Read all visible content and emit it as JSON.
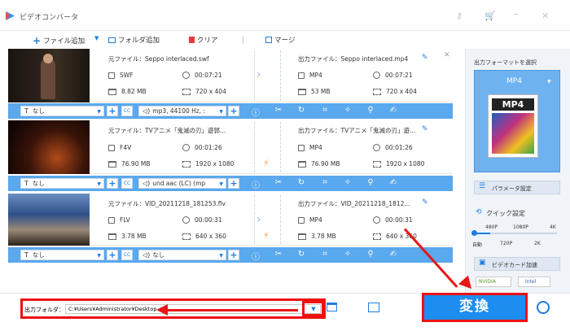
{
  "window": {
    "title": "ビデオコンバータ",
    "icons": [
      "key-icon",
      "cart-icon",
      "minimize-icon",
      "close-icon"
    ]
  },
  "toolbar": {
    "add_file": "ファイル追加",
    "add_folder": "フォルダ追加",
    "clear": "クリア",
    "merge": "マージ"
  },
  "files": [
    {
      "source_label": "元ファイル：",
      "source_name": "Seppo interlaced.swf",
      "src_format": "SWF",
      "src_duration": "00:07:21",
      "src_size": "8.82 MB",
      "src_resolution": "720 x 404",
      "output_label": "出力ファイル：",
      "output_name": "Seppo interlaced.mp4",
      "out_format": "MP4",
      "out_duration": "00:07:21",
      "out_size": "53 MB",
      "out_resolution": "720 x 404",
      "subtitle": "なし",
      "audio": "mp3, 44100 Hz, :"
    },
    {
      "source_label": "元ファイル：",
      "source_name": "TVアニメ「鬼滅の刃」遊郭...",
      "src_format": "F4V",
      "src_duration": "00:01:26",
      "src_size": "76.90 MB",
      "src_resolution": "1920 x 1080",
      "output_label": "出力ファイル：",
      "output_name": "TVアニメ「鬼滅の刃」遊...",
      "out_format": "MP4",
      "out_duration": "00:01:26",
      "out_size": "76.90 MB",
      "out_resolution": "1920 x 1080",
      "subtitle": "なし",
      "audio": "und aac (LC) (mp"
    },
    {
      "source_label": "元ファイル：",
      "source_name": "VID_20211218_181253.flv",
      "src_format": "FLV",
      "src_duration": "00:00:31",
      "src_size": "3.78 MB",
      "src_resolution": "640 x 360",
      "output_label": "出力ファイル：",
      "output_name": "VID_20211218_1812...",
      "out_format": "MP4",
      "out_duration": "00:00:31",
      "out_size": "3.78 MB",
      "out_resolution": "640 x 360",
      "subtitle": "なし",
      "audio": "なし"
    }
  ],
  "right_panel": {
    "output_format_heading": "出力フォーマットを選択",
    "format_selected": "MP4",
    "format_icon_label": "MP4",
    "params_button": "パラメータ設定",
    "quick_settings": "クイック設定",
    "quality_top": [
      "480P",
      "1080P",
      "4K"
    ],
    "quality_bottom": [
      "自動",
      "720P",
      "2K"
    ],
    "gpu_accel": "ビデオカード加速",
    "gpu_nvidia": "NVIDIA",
    "gpu_intel": "intel"
  },
  "bottom": {
    "output_folder_label": "出力フォルダ：",
    "output_path": "C:¥Users¥Administrator¥Desktop",
    "convert_label": "変換"
  },
  "colors": {
    "accent": "#1e8df0",
    "action_bar": "#5aa8ee",
    "highlight": "#ee1111"
  }
}
